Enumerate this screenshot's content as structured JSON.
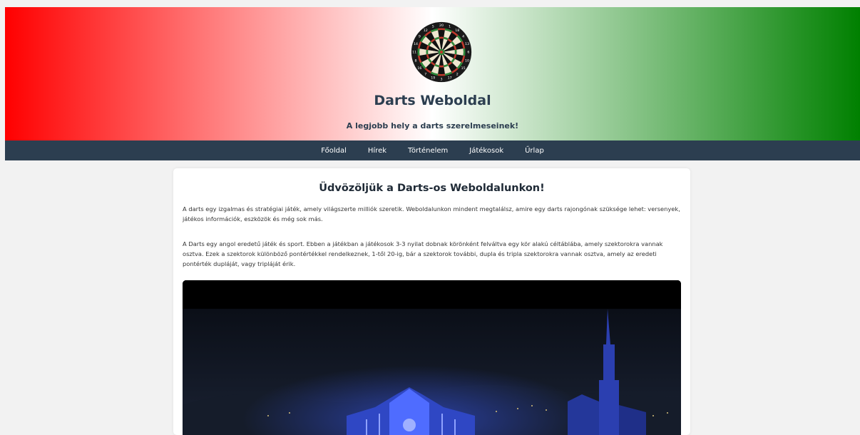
{
  "header": {
    "title": "Darts Weboldal",
    "tagline": "A legjobb hely a darts szerelmeseinek!",
    "gradient_colors": [
      "#ff0000",
      "#ffffff",
      "#008000"
    ],
    "logo_icon": "dartboard-icon"
  },
  "nav": {
    "items": [
      "Főoldal",
      "Hírek",
      "Történelem",
      "Játékosok",
      "Űrlap"
    ],
    "background": "#2c3e50"
  },
  "main": {
    "heading": "Üdvözöljük a Darts-os Weboldalunkon!",
    "paragraphs": [
      "A darts egy izgalmas és stratégiai játék, amely világszerte milliók szeretik. Weboldalunkon mindent megtalálsz, amire egy darts rajongónak szüksége lehet: versenyek, játékos információk, eszközök és még sok más.",
      "A Darts egy angol eredetű játék és sport. Ebben a játékban a játékosok 3-3 nyilat dobnak körönként felváltva egy kör alakú céltáblába, amely szektorokra vannak osztva. Ezek a szektorok különböző pontértékkel rendelkeznek, 1-től 20-ig, bár a szektorok további, dupla és tripla szektorokra vannak osztva, amely az eredeti pontérték dupláját, vagy tripláját érik."
    ],
    "video_icon": "night-building-video"
  }
}
